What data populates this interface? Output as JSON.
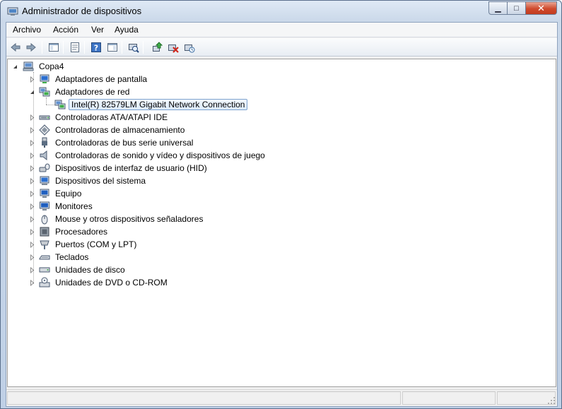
{
  "window": {
    "title": "Administrador de dispositivos",
    "icons": {
      "app": "device-manager-icon"
    },
    "caption": {
      "minimize": "▁",
      "maximize": "□",
      "close": "✕"
    }
  },
  "menu": [
    {
      "label": "Archivo"
    },
    {
      "label": "Acción"
    },
    {
      "label": "Ver"
    },
    {
      "label": "Ayuda"
    }
  ],
  "toolbar": [
    "back-arrow-icon",
    "forward-arrow-icon",
    "console-tree-icon",
    "properties-sheet-icon",
    "help-icon",
    "show-hide-pane-icon",
    "scan-hardware-icon",
    "update-driver-icon",
    "disable-device-icon",
    "uninstall-device-icon"
  ],
  "tree": {
    "root": {
      "label": "Copa4",
      "icon": "computer-icon"
    },
    "categories": [
      {
        "label": "Adaptadores de pantalla",
        "icon": "display-adapter-icon",
        "expanded": false
      },
      {
        "label": "Adaptadores de red",
        "icon": "network-adapter-icon",
        "expanded": true,
        "children": [
          {
            "label": "Intel(R) 82579LM Gigabit Network Connection",
            "icon": "network-adapter-icon",
            "selected": true
          }
        ]
      },
      {
        "label": "Controladoras ATA/ATAPI IDE",
        "icon": "ide-controller-icon",
        "expanded": false
      },
      {
        "label": "Controladoras de almacenamiento",
        "icon": "storage-controller-icon",
        "expanded": false
      },
      {
        "label": "Controladoras de bus serie universal",
        "icon": "usb-icon",
        "expanded": false
      },
      {
        "label": "Controladoras de sonido y vídeo y dispositivos de juego",
        "icon": "speaker-icon",
        "expanded": false
      },
      {
        "label": "Dispositivos de interfaz de usuario (HID)",
        "icon": "hid-icon",
        "expanded": false
      },
      {
        "label": "Dispositivos del sistema",
        "icon": "system-device-icon",
        "expanded": false
      },
      {
        "label": "Equipo",
        "icon": "computer-monitor-icon",
        "expanded": false
      },
      {
        "label": "Monitores",
        "icon": "monitor-icon",
        "expanded": false
      },
      {
        "label": "Mouse y otros dispositivos señaladores",
        "icon": "mouse-icon",
        "expanded": false
      },
      {
        "label": "Procesadores",
        "icon": "processor-icon",
        "expanded": false
      },
      {
        "label": "Puertos (COM y LPT)",
        "icon": "port-icon",
        "expanded": false
      },
      {
        "label": "Teclados",
        "icon": "keyboard-icon",
        "expanded": false
      },
      {
        "label": "Unidades de disco",
        "icon": "disk-drive-icon",
        "expanded": false
      },
      {
        "label": "Unidades de DVD o CD-ROM",
        "icon": "dvd-drive-icon",
        "expanded": false
      }
    ]
  },
  "colors": {
    "accent": "#3a6ea5",
    "selection_border": "#7da2ce"
  }
}
